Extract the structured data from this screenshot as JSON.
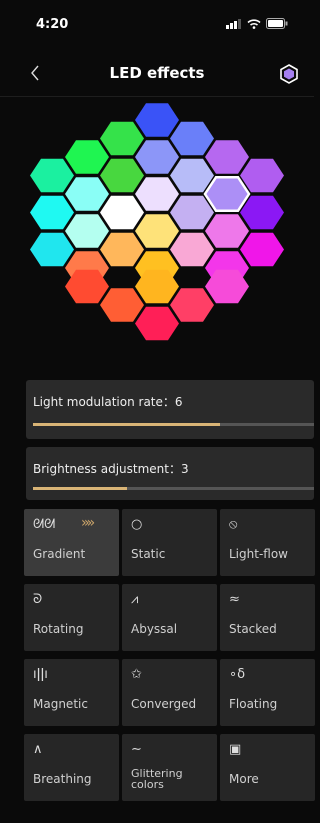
{
  "status_bar": {
    "time": "4:20"
  },
  "nav": {
    "title": "LED effects"
  },
  "colors": {
    "accent": "#d9b476",
    "device_icon": "#a57ff0",
    "hex_grid": [
      [
        "#3a53f7"
      ],
      [
        "#35e24a",
        "#6a7ff9"
      ],
      [
        "#1ff551",
        "#8c96f8",
        "#b668f0"
      ],
      [
        "#1bf0a0",
        "#48d73f",
        "#b7bcf8",
        "#b05df0"
      ],
      [
        "#8afef6",
        "#eddffe",
        "#ac8ff6"
      ],
      [
        "#1ff9f2",
        "#ffffff",
        "#c4b0f2",
        "#8b18f4"
      ],
      [
        "#b4fff0",
        "#fee279",
        "#ee78ea"
      ],
      [
        "#20e6ee",
        "#ffb75b",
        "#f9a8d5",
        "#f016e9"
      ],
      [
        "#ff7a4a",
        "#ffc021",
        "#f336ea"
      ],
      [
        "#ff4b31",
        "#ffb51f",
        "#f64bd9"
      ],
      [
        "#ff5e34",
        "#ff3f66"
      ],
      [
        "#ff1f57"
      ]
    ]
  },
  "sliders": [
    {
      "label": "Light modulation rate：6",
      "value": 6,
      "max": 9
    },
    {
      "label": "Brightness adjustment：3",
      "value": 3,
      "max": 9
    }
  ],
  "effects": [
    {
      "id": "gradient",
      "label": "Gradient",
      "icon": "gradient-icon",
      "glyph": "ᘛᘛ",
      "selected": true
    },
    {
      "id": "static",
      "label": "Static",
      "icon": "circle-icon",
      "glyph": "○",
      "selected": false
    },
    {
      "id": "light-flow",
      "label": "Light-flow",
      "icon": "light-flow-icon",
      "glyph": "⦸",
      "selected": false
    },
    {
      "id": "rotating",
      "label": "Rotating",
      "icon": "spiral-icon",
      "glyph": "ᘐ",
      "selected": false
    },
    {
      "id": "abyssal",
      "label": "Abyssal",
      "icon": "pulse-icon",
      "glyph": "⩘",
      "selected": false
    },
    {
      "id": "stacked",
      "label": "Stacked",
      "icon": "waves-icon",
      "glyph": "≈",
      "selected": false
    },
    {
      "id": "magnetic",
      "label": "Magnetic",
      "icon": "bars-icon",
      "glyph": "ıǀǀı",
      "selected": false
    },
    {
      "id": "converged",
      "label": "Converged",
      "icon": "star-icon",
      "glyph": "✩",
      "selected": false
    },
    {
      "id": "floating",
      "label": "Floating",
      "icon": "bubbles-icon",
      "glyph": "∘δ",
      "selected": false
    },
    {
      "id": "breathing",
      "label": "Breathing",
      "icon": "arc-icon",
      "glyph": "∧",
      "selected": false
    },
    {
      "id": "glittering-colors",
      "label": "Glittering\ncolors",
      "icon": "tilde-icon",
      "glyph": "∼",
      "selected": false
    },
    {
      "id": "more",
      "label": "More",
      "icon": "grid-icon",
      "glyph": "▣",
      "selected": false
    }
  ]
}
